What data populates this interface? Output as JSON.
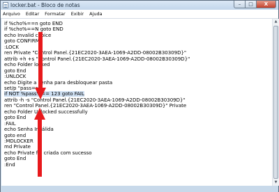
{
  "window": {
    "title": "locker.bat - Bloco de notas",
    "buttons": {
      "minimize": "–",
      "maximize": "□",
      "close": "X"
    }
  },
  "menu": [
    "Arquivo",
    "Editar",
    "Formatar",
    "Exibir",
    "Ajuda"
  ],
  "editor": {
    "lines": [
      "if %cho%==n goto END",
      "if %cho%==N goto END",
      "echo Invalid choice",
      "goto CONFIRM",
      ":LOCK",
      "ren Private \"Control Panel.{21EC2020-3AEA-1069-A2DD-08002B30309D}\"",
      "attrib +h +s \"Control Panel.{21EC2020-3AEA-1069-A2DD-08002B30309D}\"",
      "echo Folder locked",
      "goto End",
      ":UNLOCK",
      "echo Digite a senha para desbloquear pasta",
      "set/p \"pass=>\"",
      "if NOT %pass%== 123 goto FAIL",
      "attrib -h -s \"Control Panel.{21EC2020-3AEA-1069-A2DD-08002B30309D}\"",
      "ren \"Control Panel.{21EC2020-3AEA-1069-A2DD-08002B30309D}\" Private",
      "echo Folder Unlocked successfully",
      "goto End",
      ":FAIL",
      "echo Senha Inválida",
      "goto end",
      ":MDLOCKER",
      "md Private",
      "echo Private foi criada com sucesso",
      "goto End",
      ":End"
    ],
    "selected_line_index": 12
  },
  "annotation_color": "#e8191c"
}
